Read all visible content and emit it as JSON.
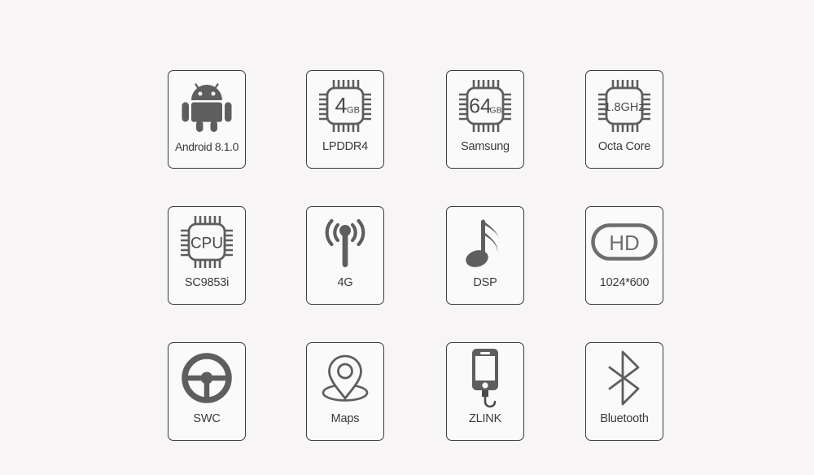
{
  "page": {
    "background_color": "#f7f5f6",
    "tile_background_color": "#fbfafa",
    "tile_border_color": "#3b3b3b",
    "icon_color": "#5e5e5e",
    "label_color": "#3a3a3a",
    "columns": 4,
    "rows": 3
  },
  "tiles": [
    {
      "id": "android",
      "label": "Android 8.1.0",
      "icon": "android-robot-icon",
      "icon_text": "",
      "row": 1,
      "column": 1
    },
    {
      "id": "ram",
      "label": "LPDDR4",
      "icon": "chip-icon",
      "icon_text": "4",
      "icon_text_unit": "GB",
      "row": 1,
      "column": 2
    },
    {
      "id": "storage",
      "label": "Samsung",
      "icon": "chip-icon",
      "icon_text": "64",
      "icon_text_unit": "GB",
      "row": 1,
      "column": 3
    },
    {
      "id": "clock-speed",
      "label": "Octa Core",
      "icon": "chip-icon",
      "icon_text": "1.8GHz",
      "icon_text_unit": "",
      "row": 1,
      "column": 4
    },
    {
      "id": "cpu",
      "label": "SC9853i",
      "icon": "chip-icon",
      "icon_text": "CPU",
      "icon_text_unit": "",
      "row": 2,
      "column": 1
    },
    {
      "id": "network",
      "label": "4G",
      "icon": "antenna-signal-icon",
      "icon_text": "",
      "row": 2,
      "column": 2
    },
    {
      "id": "audio",
      "label": "DSP",
      "icon": "music-note-icon",
      "icon_text": "",
      "row": 2,
      "column": 3
    },
    {
      "id": "resolution",
      "label": "1024*600",
      "icon": "hd-badge-icon",
      "icon_text": "HD",
      "row": 2,
      "column": 4
    },
    {
      "id": "steering-wheel-control",
      "label": "SWC",
      "icon": "steering-wheel-icon",
      "icon_text": "",
      "row": 3,
      "column": 1
    },
    {
      "id": "maps",
      "label": "Maps",
      "icon": "map-pin-icon",
      "icon_text": "",
      "row": 3,
      "column": 2
    },
    {
      "id": "zlink",
      "label": "ZLINK",
      "icon": "smartphone-cable-icon",
      "icon_text": "",
      "row": 3,
      "column": 3
    },
    {
      "id": "bluetooth",
      "label": "Bluetooth",
      "icon": "bluetooth-icon",
      "icon_text": "",
      "row": 3,
      "column": 4
    }
  ]
}
